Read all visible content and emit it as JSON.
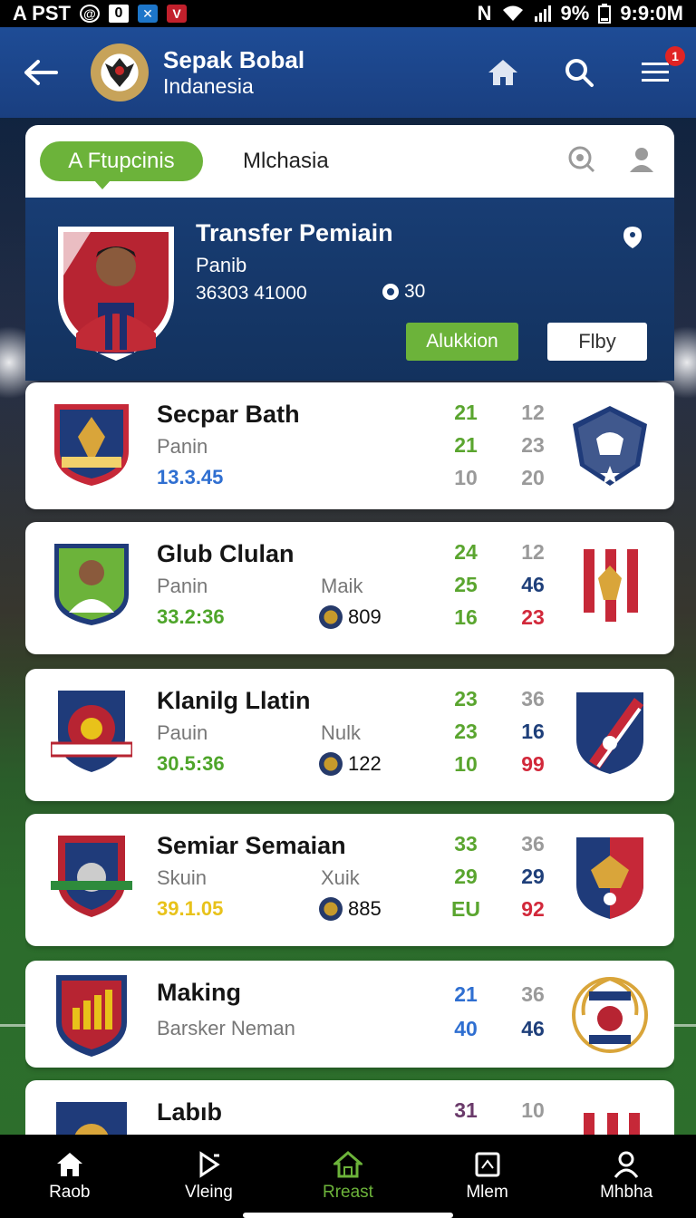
{
  "status_bar": {
    "carrier": "A PST",
    "icon_box_label": "0",
    "battery": "9%",
    "time": "9:9:0M"
  },
  "header": {
    "title": "Sepak Bobal",
    "subtitle": "Indanesia",
    "notification_count": "1"
  },
  "tabs": {
    "active_label": "A Ftupcinis",
    "second_label": "Mlchasia"
  },
  "featured": {
    "title": "Transfer Pemiain",
    "subtitle": "Panib",
    "number": "36303 41000",
    "badge_count": "30",
    "primary_button": "Alukkion",
    "secondary_button": "Flby"
  },
  "cards": [
    {
      "name": "Secpar Bath",
      "position": "Panin",
      "value": "13.3.45",
      "value_color": "#2f6fd1",
      "mid_label": "",
      "mid_value": "",
      "stats_a": [
        "21",
        "21",
        "10"
      ],
      "stats_a_colors": [
        "#5aa52f",
        "#5aa52f",
        "#9a9a9a"
      ],
      "stats_b": [
        "12",
        "23",
        "20"
      ],
      "stats_b_colors": [
        "#9a9a9a",
        "#9a9a9a",
        "#9a9a9a"
      ]
    },
    {
      "name": "Glub Clulan",
      "position": "Panin",
      "value": "33.2:36",
      "value_color": "#4ea52a",
      "mid_label": "Maik",
      "mid_value": "809",
      "stats_a": [
        "24",
        "25",
        "16"
      ],
      "stats_a_colors": [
        "#5aa52f",
        "#5aa52f",
        "#5aa52f"
      ],
      "stats_b": [
        "12",
        "46",
        "23"
      ],
      "stats_b_colors": [
        "#9a9a9a",
        "#1e3f7a",
        "#d2283a"
      ]
    },
    {
      "name": "Klanilg Llatin",
      "position": "Pauin",
      "value": "30.5:36",
      "value_color": "#4ea52a",
      "mid_label": "Nulk",
      "mid_value": "122",
      "stats_a": [
        "23",
        "23",
        "10"
      ],
      "stats_a_colors": [
        "#5aa52f",
        "#5aa52f",
        "#5aa52f"
      ],
      "stats_b": [
        "36",
        "16",
        "99"
      ],
      "stats_b_colors": [
        "#9a9a9a",
        "#1e3f7a",
        "#d2283a"
      ]
    },
    {
      "name": "Semiar Semaian",
      "position": "Skuin",
      "value": "39.1.05",
      "value_color": "#e8c21a",
      "mid_label": "Xuik",
      "mid_value": "885",
      "stats_a": [
        "33",
        "29",
        "EU"
      ],
      "stats_a_colors": [
        "#5aa52f",
        "#5aa52f",
        "#5aa52f"
      ],
      "stats_b": [
        "36",
        "29",
        "92"
      ],
      "stats_b_colors": [
        "#9a9a9a",
        "#1e3f7a",
        "#d2283a"
      ]
    },
    {
      "name": "Making",
      "position": "Barsker Neman",
      "value": "",
      "value_color": "#333333",
      "mid_label": "",
      "mid_value": "",
      "stats_a": [
        "21",
        "40"
      ],
      "stats_a_colors": [
        "#2f6fd1",
        "#2f6fd1"
      ],
      "stats_b": [
        "36",
        "46"
      ],
      "stats_b_colors": [
        "#9a9a9a",
        "#1e3f7a"
      ]
    },
    {
      "name": "Labıb",
      "position": "",
      "value": "",
      "value_color": "#333333",
      "mid_label": "",
      "mid_value": "",
      "stats_a": [
        "31"
      ],
      "stats_a_colors": [
        "#6a3a6a"
      ],
      "stats_b": [
        "10"
      ],
      "stats_b_colors": [
        "#9a9a9a"
      ]
    }
  ],
  "bottom_nav": [
    {
      "label": "Raob",
      "icon": "home-icon",
      "active": false
    },
    {
      "label": "Vleing",
      "icon": "play-icon",
      "active": false
    },
    {
      "label": "Rreast",
      "icon": "house-outline-icon",
      "active": true
    },
    {
      "label": "Mlem",
      "icon": "frame-icon",
      "active": false
    },
    {
      "label": "Mhbha",
      "icon": "user-icon",
      "active": false
    }
  ],
  "colors": {
    "header_blue": "#1e4c96",
    "accent_green": "#6cb33a",
    "featured_navy": "#183d74"
  }
}
